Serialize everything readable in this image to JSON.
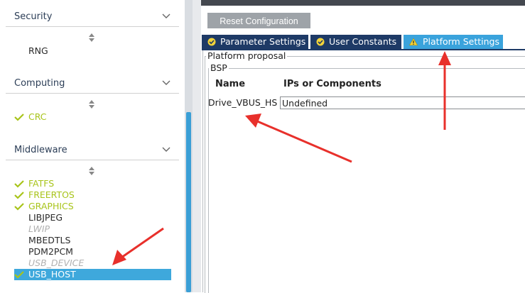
{
  "sidebar": {
    "categories": [
      {
        "title": "Security",
        "items": [
          {
            "label": "RNG",
            "state": "plain"
          }
        ]
      },
      {
        "title": "Computing",
        "items": [
          {
            "label": "CRC",
            "state": "ok"
          }
        ]
      },
      {
        "title": "Middleware",
        "items": [
          {
            "label": "FATFS",
            "state": "ok"
          },
          {
            "label": "FREERTOS",
            "state": "ok"
          },
          {
            "label": "GRAPHICS",
            "state": "ok"
          },
          {
            "label": "LIBJPEG",
            "state": "plain"
          },
          {
            "label": "LWIP",
            "state": "disabled"
          },
          {
            "label": "MBEDTLS",
            "state": "plain"
          },
          {
            "label": "PDM2PCM",
            "state": "plain"
          },
          {
            "label": "USB_DEVICE",
            "state": "disabled"
          },
          {
            "label": "USB_HOST",
            "state": "selected"
          }
        ]
      }
    ]
  },
  "toolbar": {
    "reset_label": "Reset Configuration"
  },
  "tabs": [
    {
      "label": "Parameter Settings",
      "icon": "check-circle-icon"
    },
    {
      "label": "User Constants",
      "icon": "check-circle-icon"
    },
    {
      "label": "Platform Settings",
      "icon": "warning-icon",
      "active": true
    }
  ],
  "panel": {
    "group_outer": "Platform proposal",
    "group_inner": "BSP",
    "columns": {
      "name": "Name",
      "component": "IPs or Components"
    },
    "rows": [
      {
        "name": "Drive_VBUS_HS",
        "value": "Undefined"
      }
    ]
  },
  "colors": {
    "accent": "#3aa3dc",
    "tab_bg": "#1e3a66",
    "check": "#a8c41a",
    "annotation": "#e8302b"
  }
}
